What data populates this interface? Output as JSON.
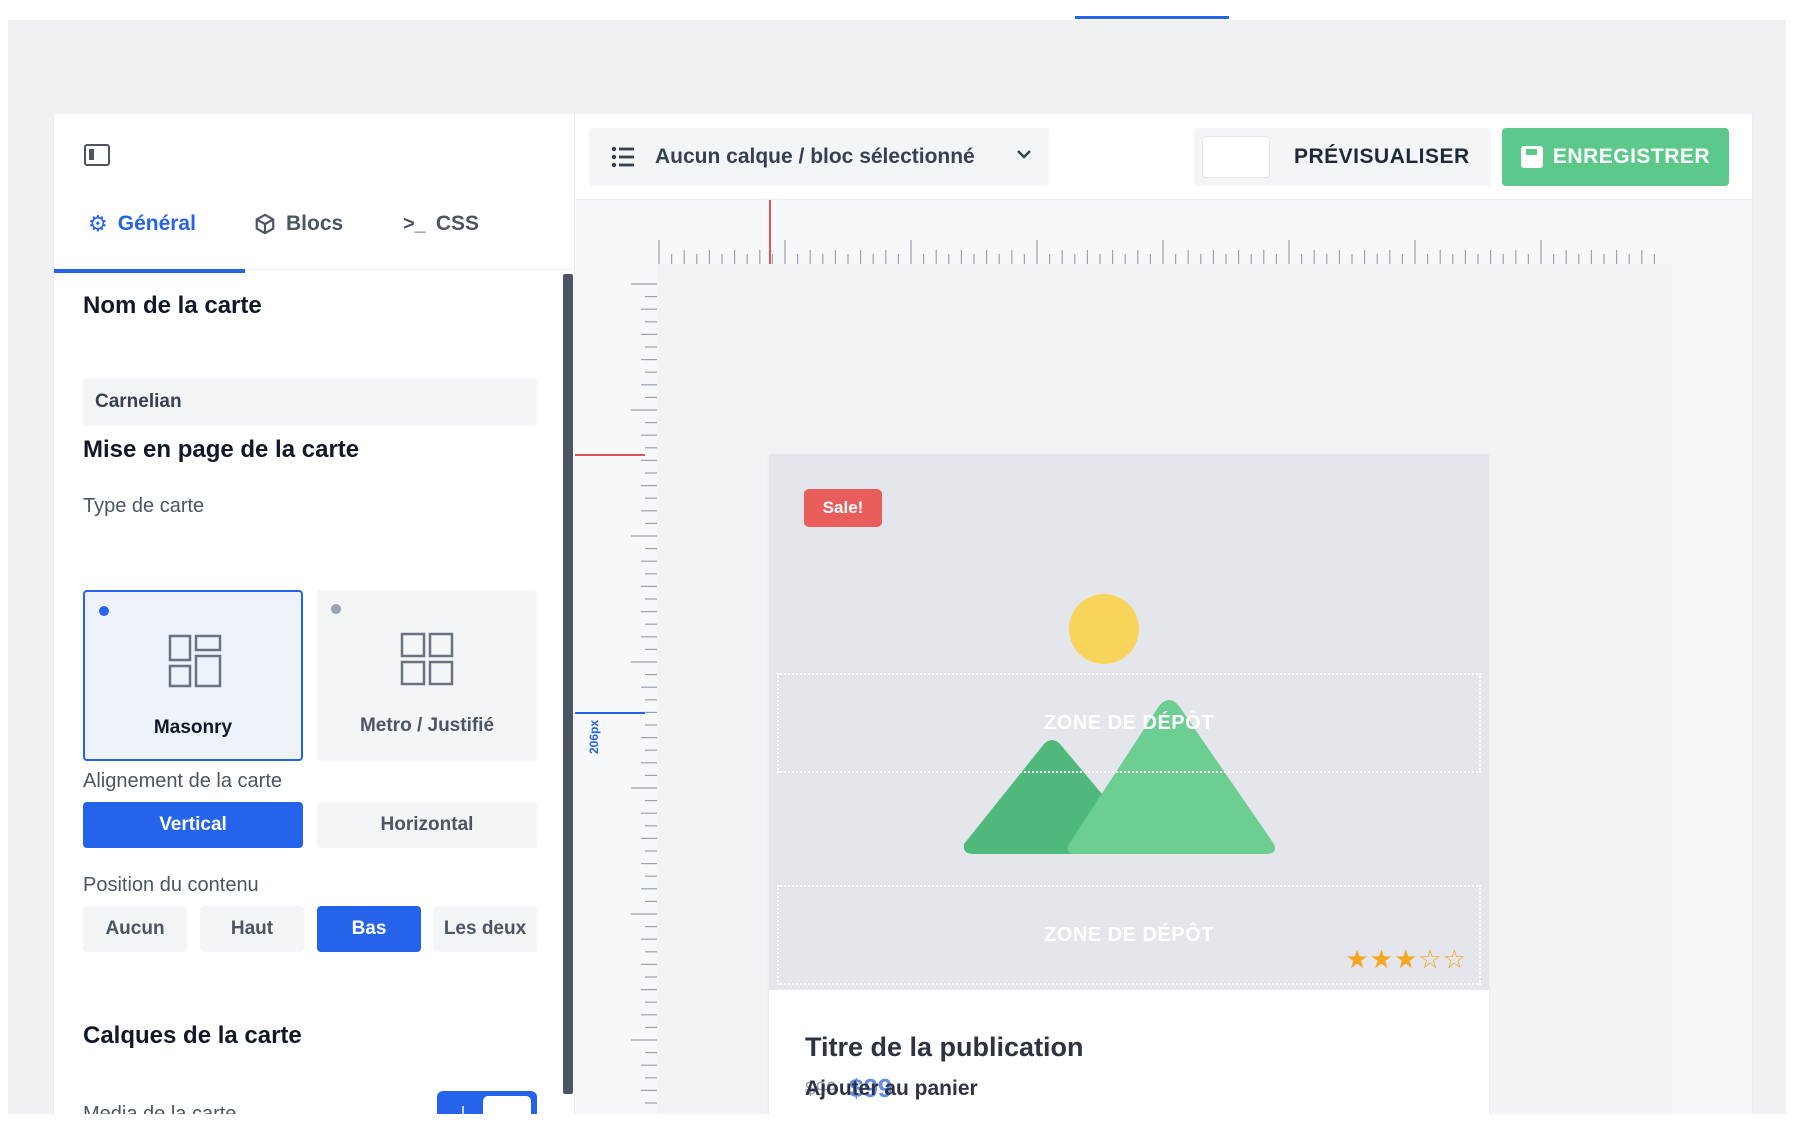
{
  "left_panel": {
    "tabs": [
      {
        "label": "Général",
        "icon": "gear-icon"
      },
      {
        "label": "Blocs",
        "icon": "cube-icon"
      },
      {
        "label": "CSS",
        "icon": "terminal-icon"
      }
    ],
    "card_name": {
      "title": "Nom de la carte",
      "value": "Carnelian"
    },
    "layout": {
      "title": "Mise en page de la carte",
      "type_label": "Type de carte",
      "types": [
        {
          "label": "Masonry",
          "selected": true
        },
        {
          "label": "Metro / Justifié",
          "selected": false
        }
      ],
      "alignment_label": "Alignement de la carte",
      "alignments": [
        {
          "label": "Vertical",
          "selected": true
        },
        {
          "label": "Horizontal",
          "selected": false
        }
      ],
      "position_label": "Position du contenu",
      "positions": [
        {
          "label": "Aucun",
          "selected": false
        },
        {
          "label": "Haut",
          "selected": false
        },
        {
          "label": "Bas",
          "selected": true
        },
        {
          "label": "Les deux",
          "selected": false
        }
      ]
    },
    "layers": {
      "title": "Calques de la carte",
      "media_label": "Media de la carte",
      "media_enabled": true
    }
  },
  "toolbar": {
    "layer_select": "Aucun calque / bloc sélectionné",
    "preview_label": "PRÉVISUALISER",
    "save_label": "ENREGISTRER",
    "save_color": "#5cc98b"
  },
  "canvas": {
    "height_label": "206px",
    "card": {
      "badge": "Sale!",
      "drop_zone_1": "ZONE DE DÉPÔT",
      "drop_zone_2": "ZONE DE DÉPÔT",
      "rating": 3,
      "rating_max": 5,
      "title": "Titre de la publication",
      "old_price": "$99",
      "price": "$99",
      "cart_link": "Ajouter au panier"
    }
  },
  "colors": {
    "accent": "#2563eb",
    "sale": "#e95d5d",
    "sun": "#f9d45a",
    "mountain_dark": "#4fb97b",
    "mountain_light": "#6ccf91",
    "star": "#f5a623"
  }
}
